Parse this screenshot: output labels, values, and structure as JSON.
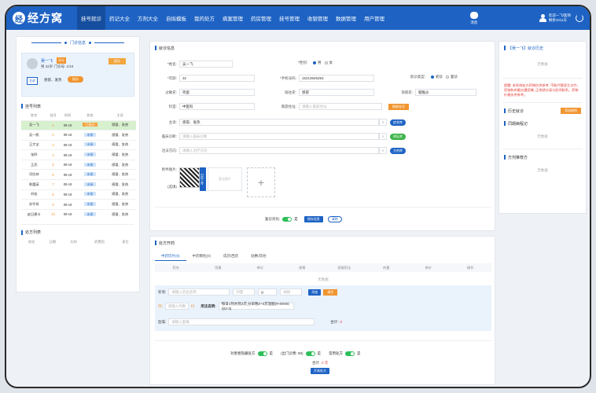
{
  "app": {
    "logo_char": "经",
    "logo_text": "经方窝"
  },
  "nav": [
    "挂号就诊",
    "药记大全",
    "方剂大全",
    "自拟模板",
    "我的处方",
    "病案管理",
    "药房管理",
    "挂号管理",
    "收银管理",
    "数据管理",
    "用户管理"
  ],
  "top": {
    "message_label": "消息",
    "user_line1": "欢迎一飞/医师",
    "user_line2": "剩余1011天"
  },
  "left": {
    "header": "门诊信息",
    "patient": {
      "name": "吴一飞",
      "badge": "初诊",
      "info": "男  32岁  门诊号: 1/10",
      "btn": "接诊",
      "tag": "主诉",
      "diagnosis": "感冒、发热",
      "btn2": "接诊"
    },
    "queue_title": "挂号列表",
    "queue_cols": [
      "姓名",
      "挂号",
      "时间",
      "状态",
      "主诉"
    ],
    "queue_rows": [
      {
        "name": "吴一飞",
        "no": "1",
        "time": "09-19",
        "status": "已接诊",
        "status_type": "orange",
        "desc": "感冒、发热"
      },
      {
        "name": "吴一帆",
        "no": "2",
        "time": "09-19",
        "status": "未接",
        "status_type": "blue",
        "desc": "感冒、发热"
      },
      {
        "name": "王大宝",
        "no": "3",
        "time": "09-19",
        "status": "未接",
        "status_type": "blue",
        "desc": "感冒、发热"
      },
      {
        "name": "张四",
        "no": "4",
        "time": "09-19",
        "status": "未接",
        "status_type": "blue",
        "desc": "感冒、发热"
      },
      {
        "name": "王武",
        "no": "5",
        "time": "09-19",
        "status": "未接",
        "status_type": "blue",
        "desc": "感冒、发热"
      },
      {
        "name": "司拉林",
        "no": "6",
        "time": "09-19",
        "status": "未接",
        "status_type": "blue",
        "desc": "感冒、发热"
      },
      {
        "name": "陈霞英",
        "no": "7",
        "time": "09-19",
        "status": "未接",
        "status_type": "blue",
        "desc": "感冒、发热"
      },
      {
        "name": "刘桂",
        "no": "8",
        "time": "09-19",
        "status": "未接",
        "status_type": "blue",
        "desc": "感冒、发热"
      },
      {
        "name": "苏华贤",
        "no": "9",
        "time": "09-19",
        "status": "未接",
        "status_type": "blue",
        "desc": "感冒、发热"
      },
      {
        "name": "赵日娜卡",
        "no": "10",
        "time": "09-19",
        "status": "未接",
        "status_type": "blue",
        "desc": "感冒、发热"
      }
    ],
    "rx_list_title": "处方列表",
    "rx_list_cols": [
      "姓名",
      "日期",
      "方剂",
      "药费用",
      "医生"
    ]
  },
  "form": {
    "title": "就诊信息",
    "name_label": "*姓名:",
    "name_value": "吴一飞",
    "gender_label": "*性别:",
    "gender_male": "男",
    "gender_female": "女",
    "age_label": "*年龄:",
    "age_value": "32",
    "phone_label": "*手机号码:",
    "phone_value": "15213645253",
    "visit_type_label": "就诊类型:",
    "visit_first": "初诊",
    "visit_return": "复诊",
    "job_label": "过敏史:",
    "job_value": "鸡蛋",
    "family_label": "既往史:",
    "family_value": "感冒",
    "history_label": "现病史:",
    "history_value": "咽喉炎",
    "dept_label": "科室:",
    "dept_value": "中医科",
    "addr_label": "家庭住址:",
    "addr_placeholder": "请输入家庭住址",
    "addr_btn": "刷新挂号",
    "complaint_label": "主诉:",
    "complaint_value": "感冒、发热",
    "complaint_btn": "症状库",
    "diag_label": "临床诊断:",
    "diag_placeholder": "请输入临床诊断",
    "diag_btn": "辨证库",
    "treat_label": "治法方向:",
    "treat_placeholder": "请输入治疗方向",
    "treat_btn": "方剂库",
    "image_label": "附件图片:",
    "image_sub": "(选填)",
    "thumb_text": "暂无图片",
    "scan_text": "扫码上传",
    "revisit_label": "复诊对比:",
    "revisit_value": "是",
    "save_btn": "保存信息",
    "reset_btn": "清除"
  },
  "rx": {
    "title": "处方开药",
    "tabs": [
      "中药饮片(0)",
      "中药颗粒(0)",
      "成药/西药",
      "贴敷/其他"
    ],
    "cols": [
      "药名",
      "用量",
      "单位",
      "规格",
      "煎服用法",
      "剂量",
      "单价",
      "操作"
    ],
    "empty": "无数据",
    "row1_label": "新增:",
    "row1_placeholder": "请输入药品名称",
    "row1_qty": "剂量",
    "row1_unit": "g",
    "row1_spec": "规格",
    "row1_btn_add": "添加",
    "row1_btn_clear": "清空",
    "row2_label": "剂:",
    "row2_placeholder": "请输入剂数",
    "row2_unit": "付",
    "row2_usage_label": "用法说明:",
    "row2_usage": "每日1剂水煎2次,分早晚2~3次温服(9-400ml,分2-3)",
    "row3_label": "医嘱:",
    "row3_placeholder": "请输入医嘱",
    "total_label": "合计:",
    "total_value": "0",
    "bottom_q1": "对患者隐藏处方",
    "bottom_v1": "是",
    "bottom_q2": "(出门诊费: 90)",
    "bottom_v2": "是",
    "bottom_q3": "常用处方",
    "bottom_v3": "是",
    "sum_label": "合计",
    "sum_value": "0 元",
    "submit_btn": "开具处方"
  },
  "right": {
    "title": "【吴一飞】就诊历史",
    "empty1": "无数据",
    "warning": "提醒: 本系统处方药物仅供参考, 不能代替医生诊疗。药物和剂量应遵医嘱, 正常就诊请与医师联系。药物价格仅供参考。",
    "recent_title": "历史就诊",
    "recent_btn": "添加病例",
    "section2": "同期病程记",
    "empty2": "无数据",
    "section3": "方剂推荐方",
    "empty3": "无数据"
  }
}
